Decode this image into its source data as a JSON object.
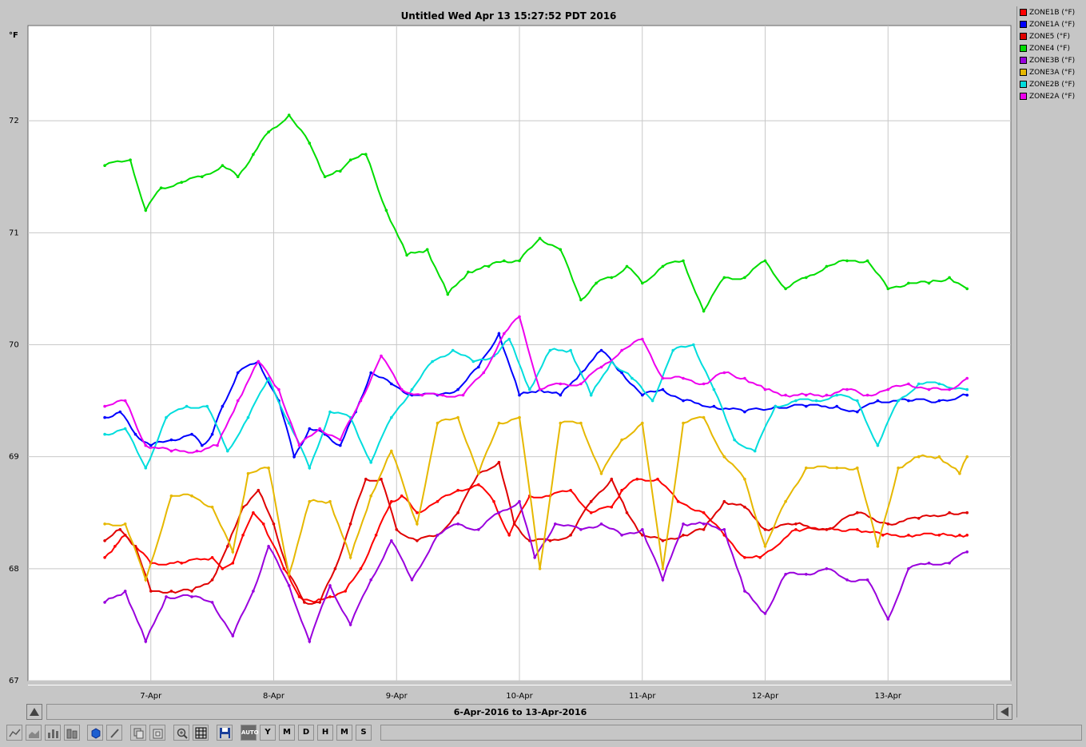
{
  "window": {
    "title": "Untitled Wed Apr 13 15:27:52 PDT 2016"
  },
  "range_label": "6-Apr-2016 to 13-Apr-2016",
  "toolbar": {
    "buttons": [
      {
        "name": "line-chart-icon"
      },
      {
        "name": "area-chart-icon"
      },
      {
        "name": "bar-chart-icon"
      },
      {
        "name": "stacked-bar-icon"
      },
      {
        "name": "3d-cube-icon"
      },
      {
        "name": "brush-icon"
      },
      {
        "name": "copy-icon"
      },
      {
        "name": "paste-icon"
      },
      {
        "name": "zoom-icon"
      },
      {
        "name": "grid-icon"
      },
      {
        "name": "save-icon"
      },
      {
        "name": "auto-button",
        "label": "AUTO"
      },
      {
        "name": "year-button",
        "label": "Y"
      },
      {
        "name": "month-button",
        "label": "M"
      },
      {
        "name": "day-button",
        "label": "D"
      },
      {
        "name": "hour-button",
        "label": "H"
      },
      {
        "name": "minute-button",
        "label": "M"
      },
      {
        "name": "second-button",
        "label": "S"
      }
    ]
  },
  "chart_data": {
    "type": "line",
    "title": "Untitled Wed Apr 13 15:27:52 PDT 2016",
    "ylabel": "°F",
    "xlabel": "",
    "ylim": [
      67,
      72.85
    ],
    "xlim": [
      "2016-04-06 00:00",
      "2016-04-14 00:00"
    ],
    "yticks": [
      "67",
      "68",
      "69",
      "70",
      "71",
      "72"
    ],
    "xticks": [
      "7-Apr",
      "8-Apr",
      "9-Apr",
      "10-Apr",
      "11-Apr",
      "12-Apr",
      "13-Apr"
    ],
    "grid": true,
    "legend_position": "right",
    "series": [
      {
        "name": "ZONE1B (°F)",
        "color": "#ff0000",
        "x": [
          "2016-04-06 15:00",
          "2016-04-06 17:00",
          "2016-04-06 19:00",
          "2016-04-06 21:00",
          "2016-04-07 00:00",
          "2016-04-07 06:00",
          "2016-04-07 12:00",
          "2016-04-07 14:00",
          "2016-04-07 16:00",
          "2016-04-07 18:00",
          "2016-04-07 20:00",
          "2016-04-07 22:00",
          "2016-04-08 02:00",
          "2016-04-08 05:00",
          "2016-04-08 08:00",
          "2016-04-08 11:00",
          "2016-04-08 14:00",
          "2016-04-08 17:00",
          "2016-04-08 20:00",
          "2016-04-08 23:00",
          "2016-04-09 01:00",
          "2016-04-09 04:00",
          "2016-04-09 08:00",
          "2016-04-09 12:00",
          "2016-04-09 16:00",
          "2016-04-09 19:00",
          "2016-04-09 22:00",
          "2016-04-10 02:00",
          "2016-04-10 06:00",
          "2016-04-10 10:00",
          "2016-04-10 14:00",
          "2016-04-10 18:00",
          "2016-04-10 20:00",
          "2016-04-10 23:00",
          "2016-04-11 03:00",
          "2016-04-11 07:00",
          "2016-04-11 12:00",
          "2016-04-11 16:00",
          "2016-04-11 20:00",
          "2016-04-11 23:00",
          "2016-04-12 06:00",
          "2016-04-12 12:00",
          "2016-04-12 18:00",
          "2016-04-12 23:00",
          "2016-04-13 04:00",
          "2016-04-13 10:00",
          "2016-04-13 14:00",
          "2016-04-13 15:27"
        ],
        "y": [
          68.1,
          68.2,
          68.3,
          68.2,
          68.05,
          68.05,
          68.1,
          68.0,
          68.05,
          68.3,
          68.5,
          68.4,
          68.0,
          67.75,
          67.7,
          67.75,
          67.8,
          68.0,
          68.3,
          68.6,
          68.65,
          68.5,
          68.6,
          68.7,
          68.75,
          68.6,
          68.3,
          68.65,
          68.65,
          68.7,
          68.5,
          68.55,
          68.7,
          68.8,
          68.8,
          68.6,
          68.5,
          68.3,
          68.1,
          68.1,
          68.35,
          68.35,
          68.35,
          68.3,
          68.3,
          68.3,
          68.3,
          68.3
        ]
      },
      {
        "name": "ZONE1A (°F)",
        "color": "#0000ff",
        "x": [
          "2016-04-06 15:00",
          "2016-04-06 18:00",
          "2016-04-06 21:00",
          "2016-04-07 00:00",
          "2016-04-07 04:00",
          "2016-04-07 08:00",
          "2016-04-07 10:00",
          "2016-04-07 12:00",
          "2016-04-07 14:00",
          "2016-04-07 17:00",
          "2016-04-07 21:00",
          "2016-04-08 01:00",
          "2016-04-08 04:00",
          "2016-04-08 07:00",
          "2016-04-08 10:00",
          "2016-04-08 13:00",
          "2016-04-08 16:00",
          "2016-04-08 19:00",
          "2016-04-08 23:00",
          "2016-04-09 03:00",
          "2016-04-09 08:00",
          "2016-04-09 12:00",
          "2016-04-09 16:00",
          "2016-04-09 20:00",
          "2016-04-10 00:00",
          "2016-04-10 04:00",
          "2016-04-10 08:00",
          "2016-04-10 12:00",
          "2016-04-10 16:00",
          "2016-04-10 20:00",
          "2016-04-11 00:00",
          "2016-04-11 04:00",
          "2016-04-11 08:00",
          "2016-04-11 14:00",
          "2016-04-11 20:00",
          "2016-04-12 02:00",
          "2016-04-12 08:00",
          "2016-04-12 14:00",
          "2016-04-12 18:00",
          "2016-04-12 22:00",
          "2016-04-13 04:00",
          "2016-04-13 10:00",
          "2016-04-13 15:27"
        ],
        "y": [
          69.35,
          69.4,
          69.2,
          69.1,
          69.15,
          69.2,
          69.1,
          69.2,
          69.45,
          69.75,
          69.85,
          69.5,
          69.0,
          69.25,
          69.2,
          69.1,
          69.4,
          69.75,
          69.65,
          69.55,
          69.55,
          69.6,
          69.8,
          70.1,
          69.55,
          69.6,
          69.55,
          69.75,
          69.95,
          69.75,
          69.55,
          69.6,
          69.5,
          69.45,
          69.4,
          69.45,
          69.45,
          69.45,
          69.4,
          69.5,
          69.5,
          69.5,
          69.55
        ]
      },
      {
        "name": "ZONE5 (°F)",
        "color": "#e00000",
        "x": [
          "2016-04-06 15:00",
          "2016-04-06 18:00",
          "2016-04-06 21:00",
          "2016-04-07 00:00",
          "2016-04-07 04:00",
          "2016-04-07 08:00",
          "2016-04-07 12:00",
          "2016-04-07 15:00",
          "2016-04-07 18:00",
          "2016-04-07 21:00",
          "2016-04-08 00:00",
          "2016-04-08 03:00",
          "2016-04-08 06:00",
          "2016-04-08 09:00",
          "2016-04-08 12:00",
          "2016-04-08 15:00",
          "2016-04-08 18:00",
          "2016-04-08 21:00",
          "2016-04-09 00:00",
          "2016-04-09 04:00",
          "2016-04-09 08:00",
          "2016-04-09 12:00",
          "2016-04-09 16:00",
          "2016-04-09 20:00",
          "2016-04-09 23:00",
          "2016-04-10 02:00",
          "2016-04-10 06:00",
          "2016-04-10 10:00",
          "2016-04-10 14:00",
          "2016-04-10 18:00",
          "2016-04-10 21:00",
          "2016-04-11 00:00",
          "2016-04-11 04:00",
          "2016-04-11 08:00",
          "2016-04-11 12:00",
          "2016-04-11 16:00",
          "2016-04-11 20:00",
          "2016-04-12 00:00",
          "2016-04-12 06:00",
          "2016-04-12 12:00",
          "2016-04-12 18:00",
          "2016-04-13 00:00",
          "2016-04-13 06:00",
          "2016-04-13 12:00",
          "2016-04-13 15:27"
        ],
        "y": [
          68.25,
          68.35,
          68.2,
          67.8,
          67.8,
          67.8,
          67.9,
          68.2,
          68.55,
          68.7,
          68.4,
          67.95,
          67.7,
          67.7,
          68.0,
          68.4,
          68.8,
          68.8,
          68.35,
          68.25,
          68.3,
          68.5,
          68.85,
          68.95,
          68.4,
          68.25,
          68.25,
          68.3,
          68.6,
          68.8,
          68.5,
          68.3,
          68.25,
          68.3,
          68.35,
          68.6,
          68.55,
          68.35,
          68.4,
          68.35,
          68.5,
          68.4,
          68.45,
          68.5,
          68.5
        ]
      },
      {
        "name": "ZONE4 (°F)",
        "color": "#00dd00",
        "x": [
          "2016-04-06 15:00",
          "2016-04-06 20:00",
          "2016-04-06 23:00",
          "2016-04-07 02:00",
          "2016-04-07 06:00",
          "2016-04-07 10:00",
          "2016-04-07 14:00",
          "2016-04-07 17:00",
          "2016-04-07 20:00",
          "2016-04-07 23:00",
          "2016-04-08 03:00",
          "2016-04-08 07:00",
          "2016-04-08 10:00",
          "2016-04-08 13:00",
          "2016-04-08 15:00",
          "2016-04-08 18:00",
          "2016-04-08 22:00",
          "2016-04-09 02:00",
          "2016-04-09 06:00",
          "2016-04-09 10:00",
          "2016-04-09 14:00",
          "2016-04-09 18:00",
          "2016-04-09 21:00",
          "2016-04-10 00:00",
          "2016-04-10 04:00",
          "2016-04-10 08:00",
          "2016-04-10 12:00",
          "2016-04-10 15:00",
          "2016-04-10 18:00",
          "2016-04-10 21:00",
          "2016-04-11 00:00",
          "2016-04-11 04:00",
          "2016-04-11 08:00",
          "2016-04-11 12:00",
          "2016-04-11 16:00",
          "2016-04-11 20:00",
          "2016-04-12 00:00",
          "2016-04-12 04:00",
          "2016-04-12 08:00",
          "2016-04-12 12:00",
          "2016-04-12 16:00",
          "2016-04-12 20:00",
          "2016-04-13 00:00",
          "2016-04-13 04:00",
          "2016-04-13 08:00",
          "2016-04-13 12:00",
          "2016-04-13 15:27"
        ],
        "y": [
          71.6,
          71.65,
          71.2,
          71.4,
          71.45,
          71.5,
          71.6,
          71.5,
          71.7,
          71.9,
          72.05,
          71.8,
          71.5,
          71.55,
          71.65,
          71.7,
          71.2,
          70.8,
          70.85,
          70.45,
          70.65,
          70.7,
          70.75,
          70.75,
          70.95,
          70.85,
          70.4,
          70.55,
          70.6,
          70.7,
          70.55,
          70.7,
          70.75,
          70.3,
          70.6,
          70.6,
          70.75,
          70.5,
          70.6,
          70.7,
          70.75,
          70.75,
          70.5,
          70.55,
          70.55,
          70.6,
          70.5
        ]
      },
      {
        "name": "ZONE3B (°F)",
        "color": "#9900dd",
        "x": [
          "2016-04-06 15:00",
          "2016-04-06 19:00",
          "2016-04-06 23:00",
          "2016-04-07 03:00",
          "2016-04-07 08:00",
          "2016-04-07 12:00",
          "2016-04-07 16:00",
          "2016-04-07 20:00",
          "2016-04-07 23:00",
          "2016-04-08 03:00",
          "2016-04-08 07:00",
          "2016-04-08 11:00",
          "2016-04-08 15:00",
          "2016-04-08 19:00",
          "2016-04-08 23:00",
          "2016-04-09 03:00",
          "2016-04-09 08:00",
          "2016-04-09 12:00",
          "2016-04-09 16:00",
          "2016-04-09 20:00",
          "2016-04-10 00:00",
          "2016-04-10 03:00",
          "2016-04-10 07:00",
          "2016-04-10 12:00",
          "2016-04-10 16:00",
          "2016-04-10 20:00",
          "2016-04-11 00:00",
          "2016-04-11 04:00",
          "2016-04-11 08:00",
          "2016-04-11 12:00",
          "2016-04-11 16:00",
          "2016-04-11 20:00",
          "2016-04-12 00:00",
          "2016-04-12 04:00",
          "2016-04-12 08:00",
          "2016-04-12 12:00",
          "2016-04-12 16:00",
          "2016-04-12 20:00",
          "2016-04-13 00:00",
          "2016-04-13 04:00",
          "2016-04-13 08:00",
          "2016-04-13 12:00",
          "2016-04-13 15:27"
        ],
        "y": [
          67.7,
          67.8,
          67.35,
          67.75,
          67.75,
          67.7,
          67.4,
          67.8,
          68.2,
          67.85,
          67.35,
          67.85,
          67.5,
          67.9,
          68.25,
          67.9,
          68.3,
          68.4,
          68.35,
          68.5,
          68.6,
          68.1,
          68.4,
          68.35,
          68.4,
          68.3,
          68.35,
          67.9,
          68.4,
          68.4,
          68.35,
          67.8,
          67.6,
          67.95,
          67.95,
          68.0,
          67.9,
          67.9,
          67.55,
          68.0,
          68.05,
          68.05,
          68.15
        ]
      },
      {
        "name": "ZONE3A (°F)",
        "color": "#e6b800",
        "x": [
          "2016-04-06 15:00",
          "2016-04-06 19:00",
          "2016-04-06 23:00",
          "2016-04-07 04:00",
          "2016-04-07 08:00",
          "2016-04-07 12:00",
          "2016-04-07 16:00",
          "2016-04-07 19:00",
          "2016-04-07 23:00",
          "2016-04-08 03:00",
          "2016-04-08 07:00",
          "2016-04-08 11:00",
          "2016-04-08 15:00",
          "2016-04-08 19:00",
          "2016-04-08 23:00",
          "2016-04-09 04:00",
          "2016-04-09 08:00",
          "2016-04-09 12:00",
          "2016-04-09 16:00",
          "2016-04-09 20:00",
          "2016-04-10 00:00",
          "2016-04-10 04:00",
          "2016-04-10 08:00",
          "2016-04-10 12:00",
          "2016-04-10 16:00",
          "2016-04-10 20:00",
          "2016-04-11 00:00",
          "2016-04-11 04:00",
          "2016-04-11 08:00",
          "2016-04-11 12:00",
          "2016-04-11 16:00",
          "2016-04-11 20:00",
          "2016-04-12 00:00",
          "2016-04-12 04:00",
          "2016-04-12 08:00",
          "2016-04-12 14:00",
          "2016-04-12 18:00",
          "2016-04-12 22:00",
          "2016-04-13 02:00",
          "2016-04-13 06:00",
          "2016-04-13 10:00",
          "2016-04-13 14:00",
          "2016-04-13 15:27"
        ],
        "y": [
          68.4,
          68.4,
          67.9,
          68.65,
          68.65,
          68.55,
          68.15,
          68.85,
          68.9,
          67.95,
          68.6,
          68.6,
          68.1,
          68.65,
          69.05,
          68.4,
          69.3,
          69.35,
          68.85,
          69.3,
          69.35,
          68.0,
          69.3,
          69.3,
          68.85,
          69.15,
          69.3,
          68.0,
          69.3,
          69.35,
          69.0,
          68.8,
          68.2,
          68.6,
          68.9,
          68.9,
          68.9,
          68.2,
          68.9,
          69.0,
          69.0,
          68.85,
          69.0
        ]
      },
      {
        "name": "ZONE2B (°F)",
        "color": "#00dddd",
        "x": [
          "2016-04-06 15:00",
          "2016-04-06 19:00",
          "2016-04-06 23:00",
          "2016-04-07 03:00",
          "2016-04-07 07:00",
          "2016-04-07 11:00",
          "2016-04-07 15:00",
          "2016-04-07 19:00",
          "2016-04-07 23:00",
          "2016-04-08 03:00",
          "2016-04-08 07:00",
          "2016-04-08 11:00",
          "2016-04-08 15:00",
          "2016-04-08 19:00",
          "2016-04-08 23:00",
          "2016-04-09 03:00",
          "2016-04-09 07:00",
          "2016-04-09 11:00",
          "2016-04-09 15:00",
          "2016-04-09 19:00",
          "2016-04-09 22:00",
          "2016-04-10 02:00",
          "2016-04-10 06:00",
          "2016-04-10 10:00",
          "2016-04-10 14:00",
          "2016-04-10 18:00",
          "2016-04-10 22:00",
          "2016-04-11 02:00",
          "2016-04-11 06:00",
          "2016-04-11 10:00",
          "2016-04-11 14:00",
          "2016-04-11 18:00",
          "2016-04-11 22:00",
          "2016-04-12 02:00",
          "2016-04-12 06:00",
          "2016-04-12 10:00",
          "2016-04-12 14:00",
          "2016-04-12 18:00",
          "2016-04-12 22:00",
          "2016-04-13 02:00",
          "2016-04-13 06:00",
          "2016-04-13 10:00",
          "2016-04-13 15:27"
        ],
        "y": [
          69.2,
          69.25,
          68.9,
          69.35,
          69.45,
          69.45,
          69.05,
          69.35,
          69.7,
          69.3,
          68.9,
          69.4,
          69.35,
          68.95,
          69.35,
          69.6,
          69.85,
          69.95,
          69.85,
          69.9,
          70.05,
          69.6,
          69.95,
          69.95,
          69.55,
          69.85,
          69.7,
          69.5,
          69.95,
          70.0,
          69.6,
          69.15,
          69.05,
          69.45,
          69.5,
          69.5,
          69.55,
          69.5,
          69.1,
          69.5,
          69.65,
          69.65,
          69.6
        ]
      },
      {
        "name": "ZONE2A (°F)",
        "color": "#ee00ee",
        "x": [
          "2016-04-06 15:00",
          "2016-04-06 19:00",
          "2016-04-06 23:00",
          "2016-04-07 04:00",
          "2016-04-07 09:00",
          "2016-04-07 13:00",
          "2016-04-07 17:00",
          "2016-04-07 21:00",
          "2016-04-08 01:00",
          "2016-04-08 05:00",
          "2016-04-08 09:00",
          "2016-04-08 13:00",
          "2016-04-08 17:00",
          "2016-04-08 21:00",
          "2016-04-09 01:00",
          "2016-04-09 05:00",
          "2016-04-09 09:00",
          "2016-04-09 13:00",
          "2016-04-09 17:00",
          "2016-04-09 21:00",
          "2016-04-10 00:00",
          "2016-04-10 04:00",
          "2016-04-10 08:00",
          "2016-04-10 12:00",
          "2016-04-10 16:00",
          "2016-04-10 20:00",
          "2016-04-11 00:00",
          "2016-04-11 04:00",
          "2016-04-11 08:00",
          "2016-04-11 12:00",
          "2016-04-11 16:00",
          "2016-04-11 20:00",
          "2016-04-12 00:00",
          "2016-04-12 04:00",
          "2016-04-12 08:00",
          "2016-04-12 12:00",
          "2016-04-12 16:00",
          "2016-04-12 20:00",
          "2016-04-13 00:00",
          "2016-04-13 04:00",
          "2016-04-13 08:00",
          "2016-04-13 12:00",
          "2016-04-13 15:27"
        ],
        "y": [
          69.45,
          69.5,
          69.1,
          69.05,
          69.05,
          69.1,
          69.5,
          69.85,
          69.6,
          69.1,
          69.25,
          69.15,
          69.5,
          69.9,
          69.6,
          69.55,
          69.55,
          69.55,
          69.75,
          70.1,
          70.25,
          69.6,
          69.65,
          69.65,
          69.8,
          69.95,
          70.05,
          69.7,
          69.7,
          69.65,
          69.75,
          69.7,
          69.6,
          69.55,
          69.55,
          69.55,
          69.6,
          69.55,
          69.6,
          69.65,
          69.6,
          69.6,
          69.7
        ]
      }
    ]
  }
}
